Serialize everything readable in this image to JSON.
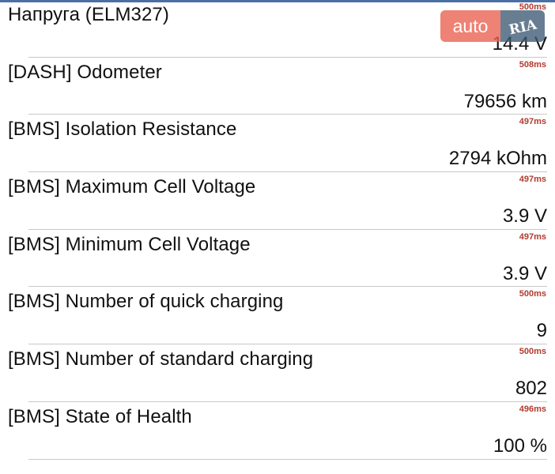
{
  "rows": [
    {
      "label": "Напруга (ELM327)",
      "ms": "500ms",
      "value": "14.4 V"
    },
    {
      "label": "[DASH] Odometer",
      "ms": "508ms",
      "value": "79656 km"
    },
    {
      "label": "[BMS] Isolation Resistance",
      "ms": "497ms",
      "value": "2794 kOhm"
    },
    {
      "label": "[BMS] Maximum Cell Voltage",
      "ms": "497ms",
      "value": "3.9 V"
    },
    {
      "label": "[BMS] Minimum Cell Voltage",
      "ms": "497ms",
      "value": "3.9 V"
    },
    {
      "label": "[BMS] Number of quick charging",
      "ms": "500ms",
      "value": "9"
    },
    {
      "label": "[BMS] Number of standard charging",
      "ms": "500ms",
      "value": "802"
    },
    {
      "label": "[BMS] State of Health",
      "ms": "496ms",
      "value": "100 %"
    }
  ],
  "watermark": {
    "text": "auto",
    "logo_text": "RIA"
  },
  "colors": {
    "accent_bar": "#4a6fa5",
    "timing_text": "#b23b2e",
    "divider": "#c8c8c8"
  }
}
